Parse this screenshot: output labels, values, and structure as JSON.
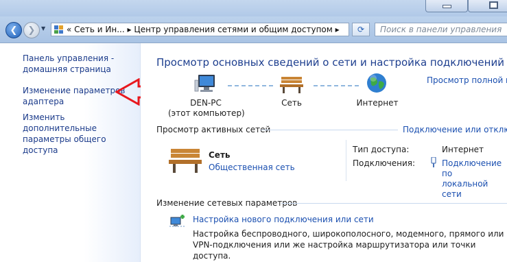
{
  "window": {
    "title_bar_buttons": [
      "minimize",
      "maximize"
    ]
  },
  "addressbar": {
    "breadcrumb_prefix": "«",
    "breadcrumb": [
      "Сеть и Ин...",
      "Центр управления сетями и общим доступом"
    ],
    "search_placeholder": "Поиск в панели управления"
  },
  "sidebar": {
    "home_link": "Панель управления -\nдомашняя страница",
    "items": [
      "Изменение параметров\nадаптера",
      "Изменить дополнительные\nпараметры общего доступа"
    ]
  },
  "main": {
    "title": "Просмотр основных сведений о сети и настройка подключений",
    "full_map_link": "Просмотр полной ка",
    "map": [
      {
        "name": "DEN-PC",
        "sub": "(этот компьютер)",
        "icon": "computer-icon"
      },
      {
        "name": "Сеть",
        "sub": "",
        "icon": "bench-icon"
      },
      {
        "name": "Интернет",
        "sub": "",
        "icon": "globe-icon"
      }
    ],
    "active_networks": {
      "title": "Просмотр активных сетей",
      "connect_link": "Подключение или отключе",
      "network_name": "Сеть",
      "network_type": "Общественная сеть",
      "access_type_label": "Тип доступа:",
      "access_type_value": "Интернет",
      "connections_label": "Подключения:",
      "connection_link": "Подключение по\nлокальной сети"
    },
    "change_settings": {
      "title": "Изменение сетевых параметров",
      "new_connection_link": "Настройка нового подключения или сети",
      "new_connection_desc": "Настройка беспроводного, широкополосного, модемного, прямого или\nVPN-подключения или же настройка маршрутизатора или точки доступа."
    }
  },
  "colors": {
    "link": "#1a4fb0",
    "title": "#1e3f8f",
    "annotation_arrow": "#e8181e"
  }
}
